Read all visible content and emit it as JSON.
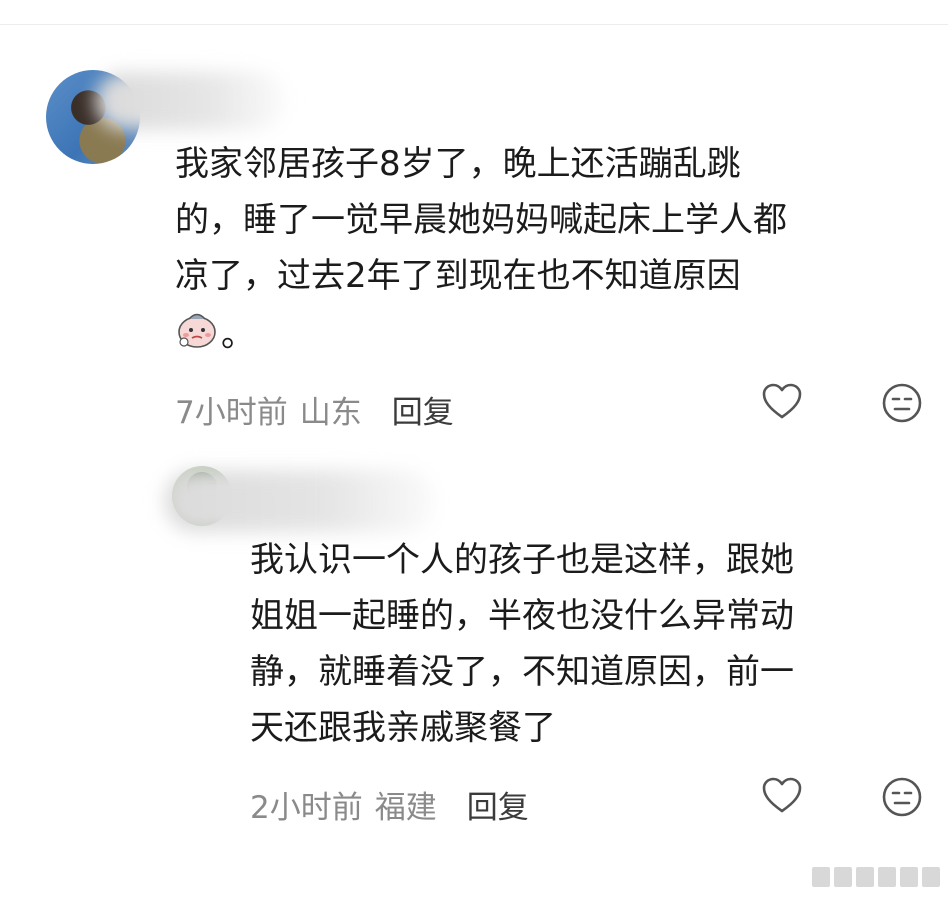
{
  "comments": [
    {
      "text": "我家邻居孩子8岁了，晚上还活蹦乱跳\n的，睡了一觉早晨她妈妈喊起床上学人都\n凉了，过去2年了到现在也不知道原因",
      "emoji_suffix": "。",
      "emoji_name": "crying-face-sticker",
      "time": "7小时前",
      "location": "山东",
      "reply_label": "回复"
    },
    {
      "text": "我认识一个人的孩子也是这样，跟她\n姐姐一起睡的，半夜也没什么异常动\n静，就睡着没了，不知道原因，前一\n天还跟我亲戚聚餐了",
      "time": "2小时前",
      "location": "福建",
      "reply_label": "回复"
    }
  ],
  "icons": {
    "like": "heart-outline-icon",
    "react": "neutral-face-icon"
  },
  "colors": {
    "text": "#1b1b1b",
    "meta": "#8a8a8a",
    "reply": "#3b3b3b",
    "icon": "#555555"
  }
}
